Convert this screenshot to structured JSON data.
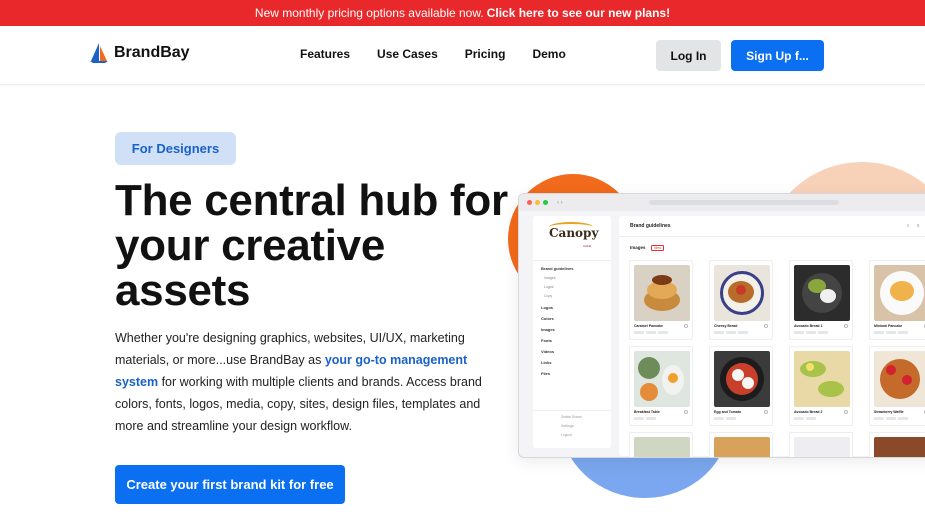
{
  "announcement": {
    "text": "New monthly pricing options available now.",
    "link": "Click here to see our new plans!"
  },
  "colors": {
    "accent": "#0a6ff0",
    "banner": "#e8282b",
    "pill_bg": "#cfe0f7"
  },
  "nav": {
    "brand": "BrandBay",
    "links": [
      "Features",
      "Use Cases",
      "Pricing",
      "Demo"
    ],
    "login": "Log In",
    "signup": "Sign Up f..."
  },
  "hero": {
    "tag": "For Designers",
    "headline": "The central hub for your creative assets",
    "para_1": "Whether you're designing graphics, websites, UI/UX, marketing materials, or more...use BrandBay as ",
    "para_link": "your go-to management system",
    "para_2": " for working with multiple clients and brands. Access brand colors, fonts, logos, media, copy, sites, design files, templates and more and streamline your design workflow.",
    "cta": "Create your first brand kit for free"
  },
  "mockup": {
    "logo": "Canopy",
    "logo_sub": "CAFE",
    "section_title": "Brand guidelines",
    "images_label": "Images",
    "new_badge": "New",
    "sidebar": [
      "Brand guidelines",
      "Logos",
      "Colors",
      "Images",
      "Fonts",
      "Videos",
      "Links",
      "Files"
    ],
    "sidebar_sub": [
      "Images",
      "Logos",
      "Copy"
    ],
    "sidebar_footer": [
      "Switch Brand",
      "Settings",
      "Logout"
    ],
    "cards": [
      "Caramel Pancake",
      "Cheesy Bread",
      "Avocado Bread 1",
      "Minimal Pancake",
      "Breakfast Table",
      "Egg and Tomato",
      "Avocado Bread 2",
      "Strawberry Waffle"
    ]
  }
}
